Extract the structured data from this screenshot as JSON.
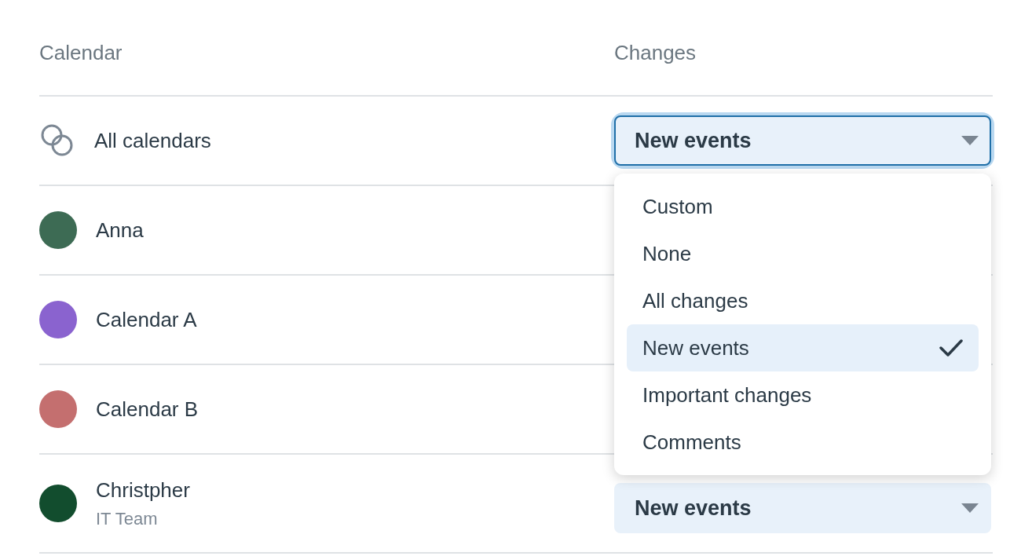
{
  "columns": [
    "Calendar",
    "Changes"
  ],
  "rows": [
    {
      "kind": "group",
      "name": "All calendars",
      "select": {
        "value": "New events",
        "focused": true,
        "open": true
      }
    },
    {
      "kind": "person",
      "name": "Anna",
      "color": "#3d6b54"
    },
    {
      "kind": "person",
      "name": "Calendar A",
      "color": "#8a63cf"
    },
    {
      "kind": "person",
      "name": "Calendar B",
      "color": "#c46f6f"
    },
    {
      "kind": "person",
      "name": "Christpher",
      "subtitle": "IT Team",
      "color": "#124d2e",
      "select": {
        "value": "New events",
        "focused": false
      }
    }
  ],
  "menu": [
    {
      "label": "Custom",
      "selected": false
    },
    {
      "label": "None",
      "selected": false
    },
    {
      "label": "All changes",
      "selected": false
    },
    {
      "label": "New events",
      "selected": true
    },
    {
      "label": "Important changes",
      "selected": false
    },
    {
      "label": "Comments",
      "selected": false
    }
  ]
}
